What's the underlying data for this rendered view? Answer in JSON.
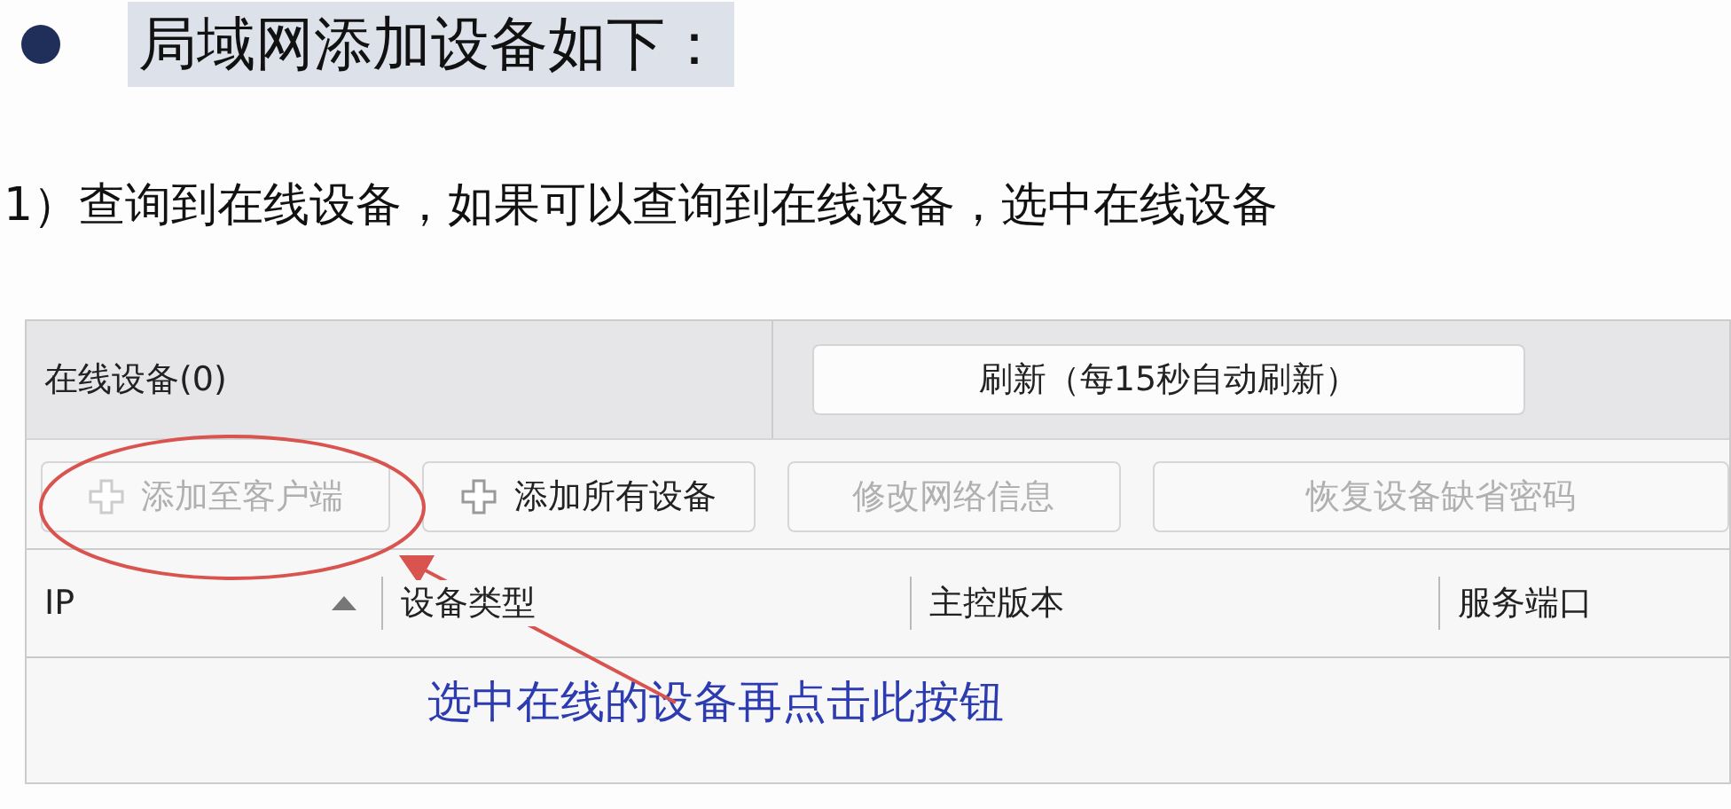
{
  "heading": {
    "text": "局域网添加设备如下："
  },
  "intro": "1）查询到在线设备，如果可以查询到在线设备，选中在线设备",
  "panel": {
    "title": "在线设备(0)",
    "refresh_button": "刷新（每15秒自动刷新）",
    "toolbar": [
      {
        "label": "添加至客户端",
        "kind": "add",
        "disabled": true
      },
      {
        "label": "添加所有设备",
        "kind": "add",
        "disabled": false
      },
      {
        "label": "修改网络信息",
        "kind": "plain",
        "disabled": true
      },
      {
        "label": "恢复设备缺省密码",
        "kind": "plain",
        "disabled": true
      }
    ],
    "columns": [
      {
        "label": "IP",
        "sorted": true
      },
      {
        "label": "设备类型",
        "sorted": false
      },
      {
        "label": "主控版本",
        "sorted": false
      },
      {
        "label": "服务端口",
        "sorted": false
      }
    ]
  },
  "annotation": {
    "text": "选中在线的设备再点击此按钮"
  }
}
